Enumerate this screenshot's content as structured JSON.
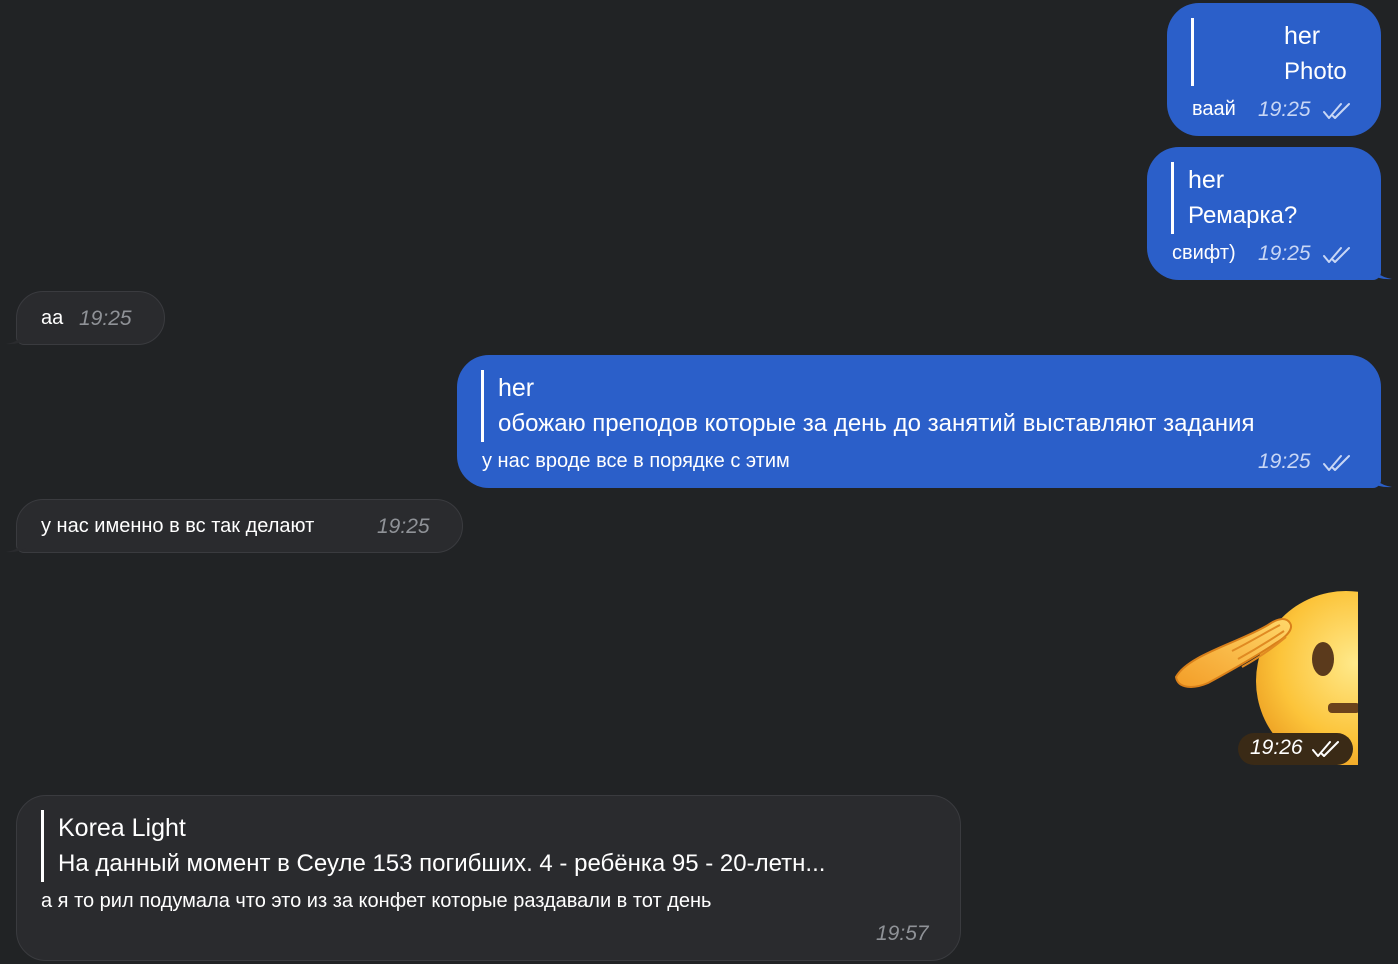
{
  "messages": [
    {
      "reply_name": "her",
      "reply_text": "Photo",
      "text": "ваай",
      "time": "19:25",
      "status": "read-double-check-icon"
    },
    {
      "reply_name": "her",
      "reply_text": "Ремарка?",
      "text": "свифт)",
      "time": "19:25",
      "status": "read-double-check-icon"
    },
    {
      "text": "аа",
      "time": "19:25"
    },
    {
      "reply_name": "her",
      "reply_text": "обожаю преподов которые за день до занятий выставляют задания",
      "text": "у нас вроде все в порядке с этим",
      "time": "19:25",
      "status": "read-double-check-icon"
    },
    {
      "text": "у нас именно в вс так делают",
      "time": "19:25"
    },
    {
      "sticker": "saluting-face-emoji",
      "time": "19:26",
      "status": "read-double-check-icon"
    },
    {
      "reply_name": "Korea Light",
      "reply_text": "На данный момент в Сеуле 153 погибших. 4 - ребёнка 95 - 20-летн...",
      "text": "а я то рил подумала что это из за конфет которые раздавали в тот день",
      "time": "19:57"
    }
  ],
  "colors": {
    "background": "#212325",
    "outgoing_bubble": "#2b5fc9",
    "incoming_bubble": "#2a2b2e"
  }
}
